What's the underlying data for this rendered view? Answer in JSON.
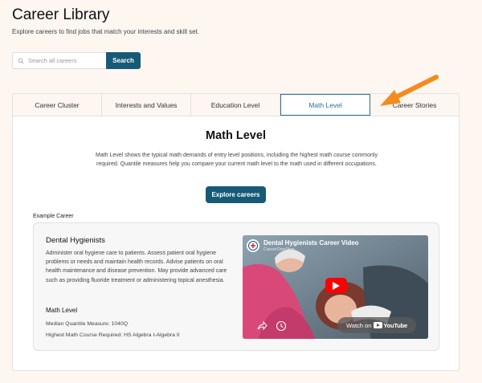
{
  "page": {
    "title": "Career Library",
    "subtitle": "Explore careers to find jobs that match your interests and skill set."
  },
  "search": {
    "placeholder": "Search all careers",
    "button_label": "Search"
  },
  "tabs": [
    {
      "label": "Career Cluster",
      "active": false
    },
    {
      "label": "Interests and Values",
      "active": false
    },
    {
      "label": "Education Level",
      "active": false
    },
    {
      "label": "Math Level",
      "active": true
    },
    {
      "label": "Career Stories",
      "active": false
    }
  ],
  "section": {
    "title": "Math Level",
    "description": "Math Level shows the typical math demands of entry level positions, including the highest math course commonly required. Quantile measures help you compare your current math level to the math used in different occupations.",
    "explore_button": "Explore careers"
  },
  "example": {
    "label": "Example Career",
    "career_name": "Dental Hygienists",
    "career_description": "Administer oral hygiene care to patients. Assess patient oral hygiene problems or needs and maintain health records. Advise patients on oral health maintenance and disease prevention. May provide advanced care such as providing fluoride treatment or administering topical anesthesia.",
    "math_heading": "Math Level",
    "quantile_measure": "Median Quantile Measure: 1040Q",
    "highest_course": "Highest Math Course Required: HS Algebra I-Algebra II"
  },
  "video": {
    "title": "Dental Hygienists Career Video",
    "channel": "CareerOneStop",
    "watch_on": "Watch on",
    "platform": "YouTube"
  },
  "colors": {
    "primary_button": "#175a78",
    "active_tab": "#2c6f95",
    "annotation_arrow": "#f28c1e",
    "background": "#fdf6f1"
  },
  "icons": [
    "search-icon",
    "play-icon",
    "share-icon",
    "clock-icon",
    "youtube-logo",
    "arrow-icon"
  ]
}
